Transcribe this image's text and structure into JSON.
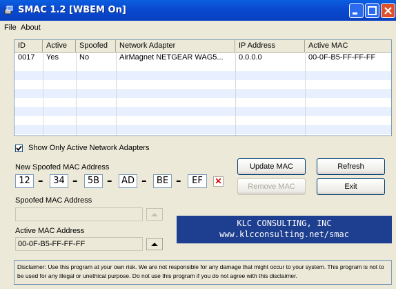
{
  "window": {
    "title": "SMAC 1.2  [WBEM On]"
  },
  "menu": [
    "File",
    "About"
  ],
  "adapters_table": {
    "columns": [
      "ID",
      "Active",
      "Spoofed",
      "Network Adapter",
      "IP Address",
      "Active MAC"
    ],
    "rows": [
      [
        "0017",
        "Yes",
        "No",
        "AirMagnet NETGEAR WAG5...",
        "0.0.0.0",
        "00-0F-B5-FF-FF-FF"
      ]
    ]
  },
  "show_active_only": {
    "label": "Show Only Active Network Adapters",
    "checked": true
  },
  "new_mac": {
    "label": "New Spoofed MAC Address",
    "octets": [
      "12",
      "34",
      "5B",
      "AD",
      "BE",
      "EF"
    ],
    "separator": "–"
  },
  "spoofed_mac": {
    "label": "Spoofed MAC Address",
    "value": ""
  },
  "active_mac": {
    "label": "Active MAC Address",
    "value": "00-0F-B5-FF-FF-FF"
  },
  "buttons": {
    "update": "Update MAC",
    "refresh": "Refresh",
    "remove": "Remove MAC",
    "exit": "Exit"
  },
  "banner": {
    "line1": "KLC CONSULTING, INC",
    "line2": "www.klcconsulting.net/smac"
  },
  "disclaimer": "Disclaimer: Use this program at your own risk.  We are not responsible for any damage that might occur to your system.  This program is not to be used for any illegal or unethical purpose.  Do not use this program if you do not agree with this disclaimer."
}
